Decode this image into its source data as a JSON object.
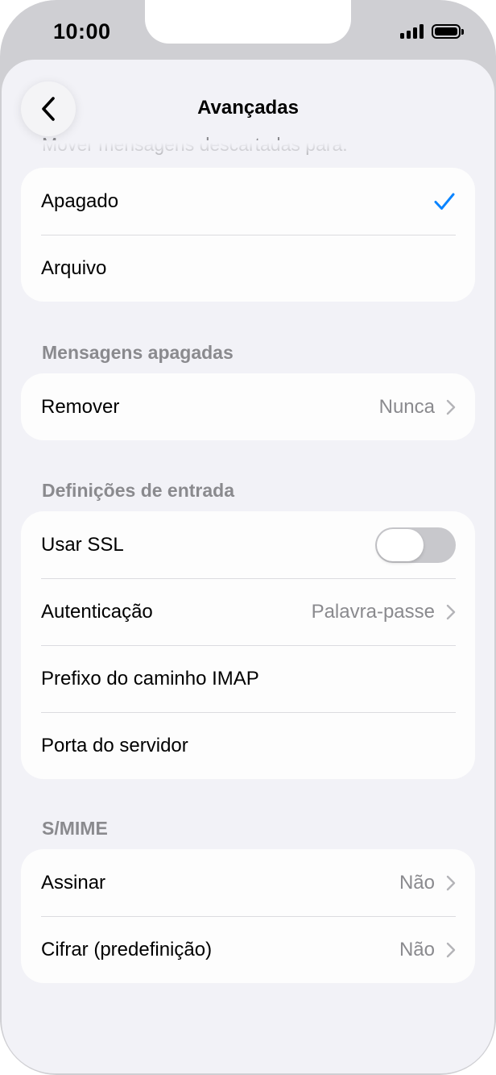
{
  "status_bar": {
    "time": "10:00"
  },
  "nav": {
    "title": "Avançadas"
  },
  "sections": {
    "discarded": {
      "header": "Mover mensagens descartadas para:",
      "options": [
        {
          "label": "Apagado",
          "selected": true
        },
        {
          "label": "Arquivo",
          "selected": false
        }
      ]
    },
    "deleted": {
      "header": "Mensagens apagadas",
      "rows": [
        {
          "label": "Remover",
          "value": "Nunca"
        }
      ]
    },
    "incoming": {
      "header": "Definições de entrada",
      "rows": [
        {
          "label": "Usar SSL",
          "toggle_on": false
        },
        {
          "label": "Autenticação",
          "value": "Palavra-passe"
        },
        {
          "label": "Prefixo do caminho IMAP"
        },
        {
          "label": "Porta do servidor"
        }
      ]
    },
    "smime": {
      "header": "S/MIME",
      "rows": [
        {
          "label": "Assinar",
          "value": "Não"
        },
        {
          "label": "Cifrar (predefinição)",
          "value": "Não"
        }
      ]
    }
  },
  "colors": {
    "accent": "#0a84ff",
    "secondary_text": "#8a8a8e",
    "background": "#f2f2f7"
  },
  "icons": {
    "back": "chevron-left-icon",
    "disclosure": "chevron-right-icon",
    "selected": "checkmark-icon"
  }
}
